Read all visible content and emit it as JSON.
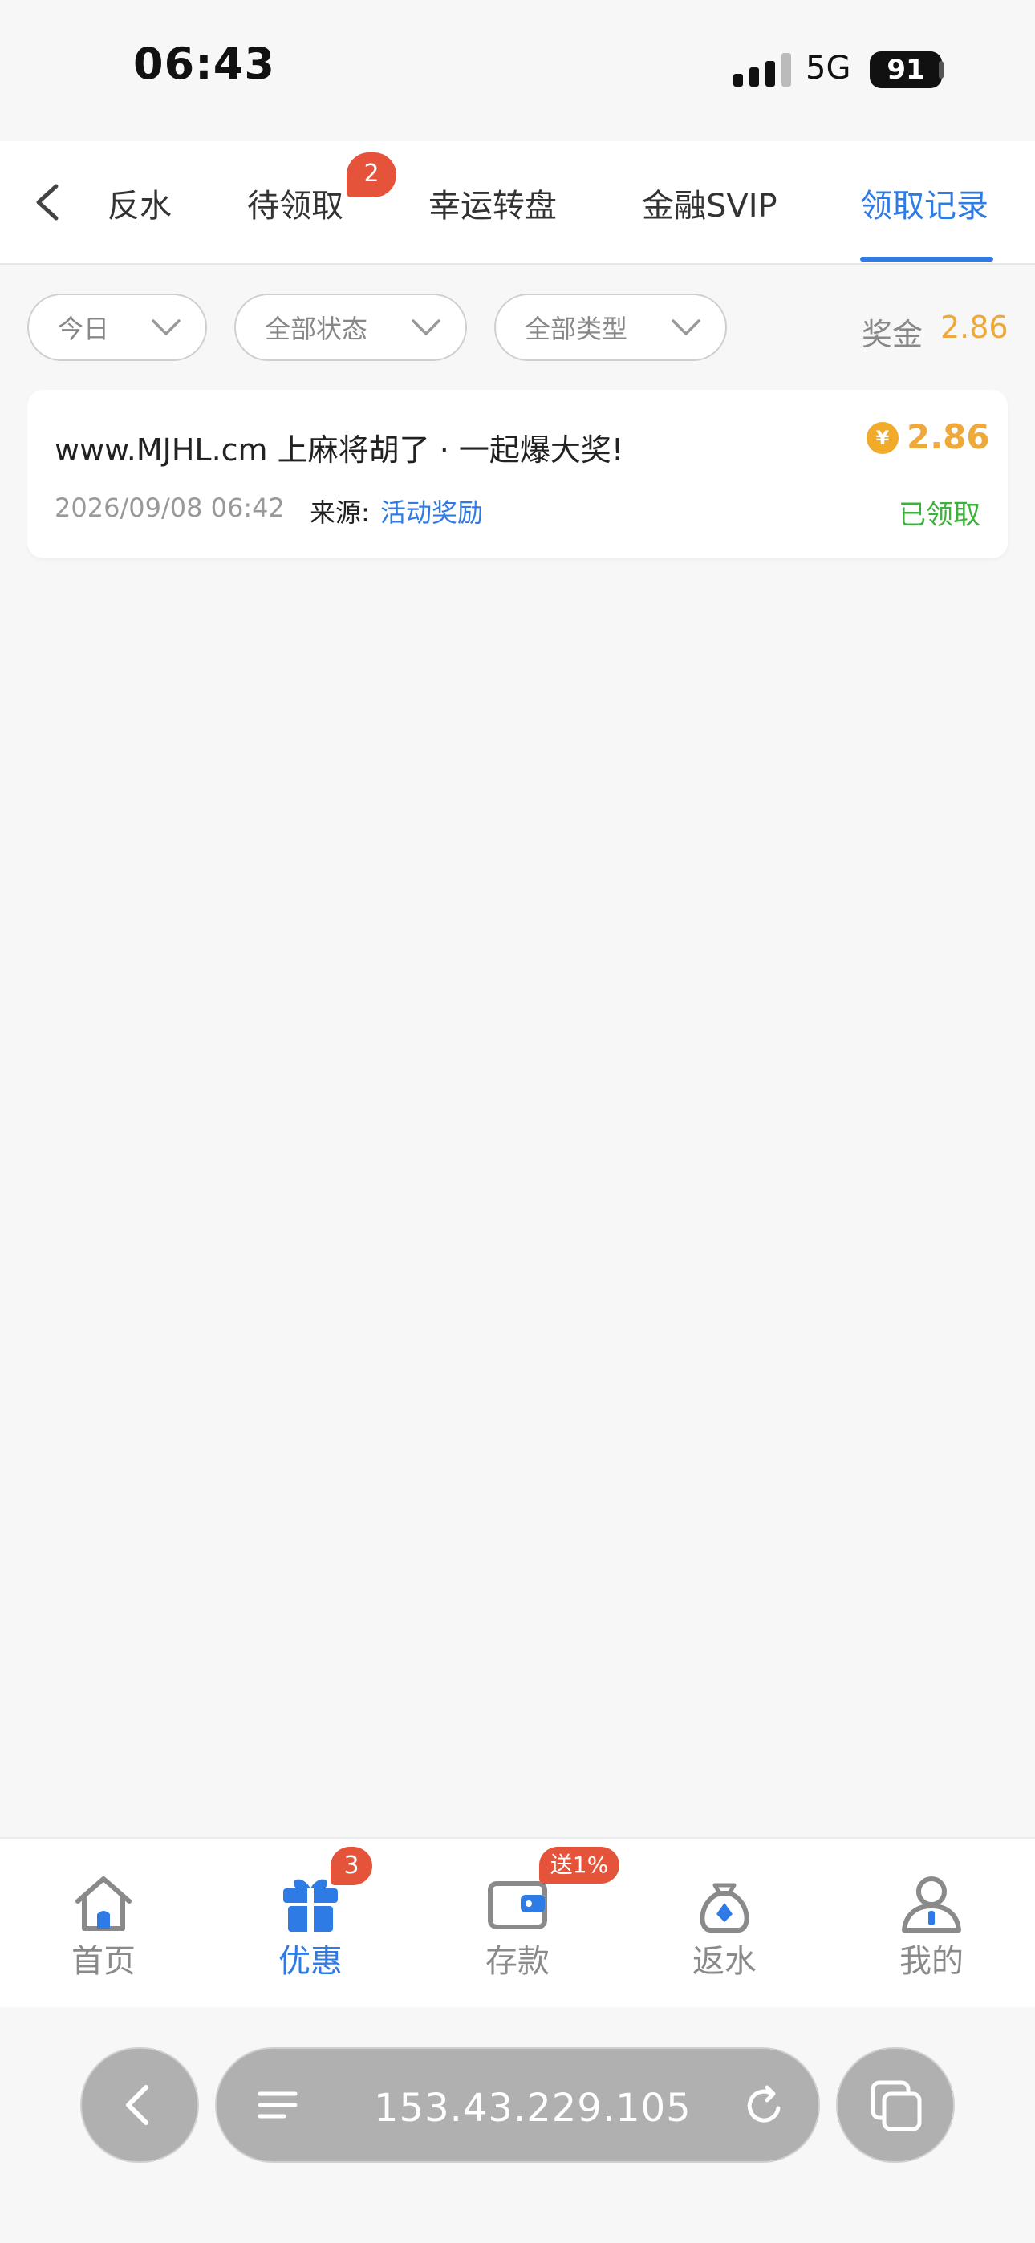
{
  "status_bar": {
    "time": "06:43",
    "network": "5G",
    "battery": "91"
  },
  "tabs": [
    {
      "label": "反水",
      "active": false
    },
    {
      "label": "待领取",
      "active": false,
      "badge": "2"
    },
    {
      "label": "幸运转盘",
      "active": false
    },
    {
      "label": "金融SVIP",
      "active": false
    },
    {
      "label": "领取记录",
      "active": true
    }
  ],
  "filters": [
    {
      "label": "今日"
    },
    {
      "label": "全部状态"
    },
    {
      "label": "全部类型"
    }
  ],
  "bonus": {
    "label": "奖金",
    "value": "2.86"
  },
  "records": [
    {
      "title": "www.MJHL.cm 上麻将胡了 · 一起爆大奖!",
      "amount": "2.86",
      "currency_symbol": "¥",
      "time": "2026/09/08 06:42",
      "source_label": "来源:",
      "source_value": "活动奖励",
      "status": "已领取"
    }
  ],
  "bottom_nav": [
    {
      "label": "首页",
      "icon": "home-icon",
      "active": false
    },
    {
      "label": "优惠",
      "icon": "gift-icon",
      "active": true,
      "badge": "3"
    },
    {
      "label": "存款",
      "icon": "wallet-icon",
      "active": false,
      "badge": "送1%"
    },
    {
      "label": "返水",
      "icon": "money-bag-icon",
      "active": false
    },
    {
      "label": "我的",
      "icon": "user-icon",
      "active": false
    }
  ],
  "browser": {
    "url": "153.43.229.105"
  },
  "colors": {
    "accent": "#2f7be6",
    "gold": "#efa93a",
    "badge": "#e5543a",
    "success": "#3bb33b"
  }
}
